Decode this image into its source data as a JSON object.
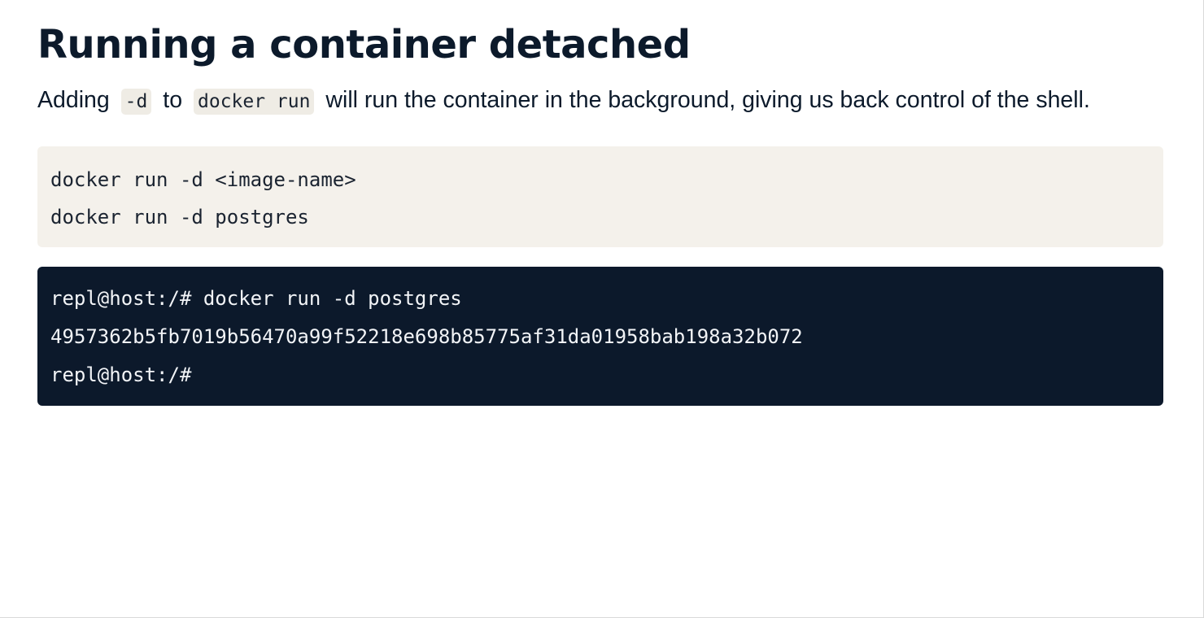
{
  "section": {
    "title": "Running a container detached",
    "intro": {
      "text_before": "Adding",
      "flag": "-d",
      "text_middle": "to",
      "command": "docker run",
      "text_after": "will run the container in the background, giving us back control of the shell."
    }
  },
  "code_block": {
    "lines": [
      "docker run -d <image-name>",
      "docker run -d postgres"
    ]
  },
  "terminal": {
    "lines": [
      "repl@host:/# docker run -d postgres",
      "4957362b5fb7019b56470a99f52218e698b85775af31da01958bab198a32b072",
      "repl@host:/#"
    ]
  }
}
